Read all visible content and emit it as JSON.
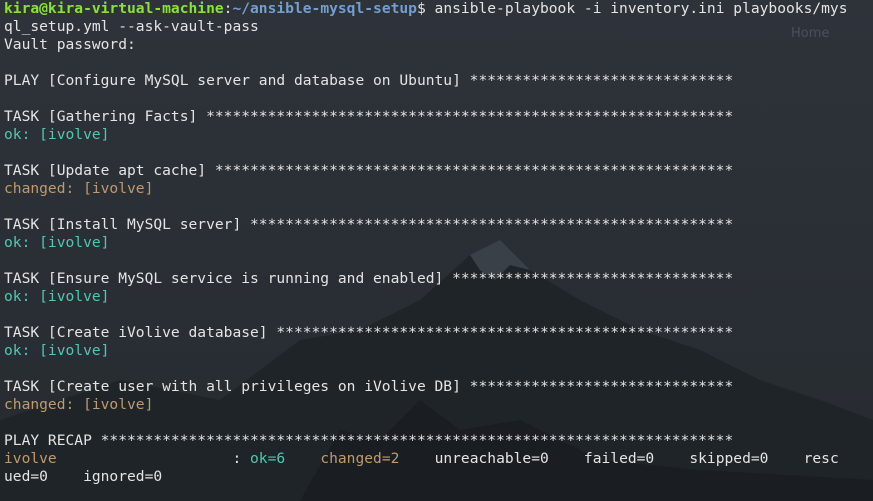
{
  "colors": {
    "background": "#2b3036",
    "text": "#e4e4e4",
    "prompt_user": "#8ae234",
    "prompt_path": "#729fcf",
    "ok": "#4ec9b0",
    "changed": "#c19a6b"
  },
  "desktop": {
    "home_label": "Home"
  },
  "terminal": {
    "prompt": {
      "user_host": "kira@kira-virtual-machine",
      "colon": ":",
      "path": "~/ansible-mysql-setup",
      "symbol": "$",
      "command_part1": " ansible-playbook -i inventory.ini playbooks/mys",
      "command_part2": "ql_setup.yml --ask-vault-pass"
    },
    "vault_prompt": "Vault password:",
    "play_header": "PLAY [Configure MySQL server and database on Ubuntu] ******************************",
    "tasks": [
      {
        "header": "TASK [Gathering Facts] ************************************************************",
        "status": "ok: [ivolve]"
      },
      {
        "header": "TASK [Update apt cache] ***********************************************************",
        "status": "changed: [ivolve]"
      },
      {
        "header": "TASK [Install MySQL server] *******************************************************",
        "status": "ok: [ivolve]"
      },
      {
        "header": "TASK [Ensure MySQL service is running and enabled] ********************************",
        "status": "ok: [ivolve]"
      },
      {
        "header": "TASK [Create iVolive database] ****************************************************",
        "status": "ok: [ivolve]"
      },
      {
        "header": "TASK [Create user with all privileges on iVolive DB] ******************************",
        "status": "changed: [ivolve]"
      }
    ],
    "recap": {
      "header": "PLAY RECAP ************************************************************************",
      "host": "ivolve",
      "separator": "                    : ",
      "ok": "ok=6",
      "changed": "changed=2",
      "rest_line1": "unreachable=0    failed=0    skipped=0    resc",
      "rest_line2": "ued=0    ignored=0"
    }
  }
}
